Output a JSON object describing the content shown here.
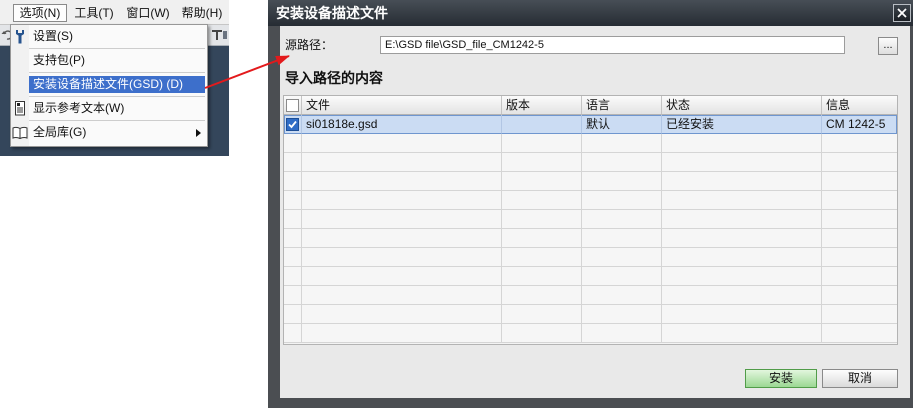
{
  "menubar": {
    "items": [
      {
        "label": "选项(N)",
        "active": true
      },
      {
        "label": "工具(T)"
      },
      {
        "label": "窗口(W)"
      },
      {
        "label": "帮助(H)"
      }
    ]
  },
  "options_menu": {
    "items": [
      {
        "label": "设置(S)",
        "icon": "wrench-icon"
      },
      {
        "label": "支持包(P)"
      },
      {
        "label": "安装设备描述文件(GSD) (D)",
        "highlighted": true
      },
      {
        "label": "显示参考文本(W)",
        "icon": "reference-text-icon"
      },
      {
        "label": "全局库(G)",
        "icon": "book-icon",
        "submenu": true
      }
    ]
  },
  "dialog": {
    "title": "安装设备描述文件",
    "close_icon": "close-icon",
    "source_path": {
      "label": "源路径：",
      "value": "E:\\GSD file\\GSD_file_CM1242-5"
    },
    "browse_label": "...",
    "section_title": "导入路径的内容",
    "table": {
      "select_all_checked": false,
      "columns": [
        "文件",
        "版本",
        "语言",
        "状态",
        "信息"
      ],
      "rows": [
        {
          "checked": true,
          "selected": true,
          "file": "si01818e.gsd",
          "version": "",
          "language": "默认",
          "status": "已经安装",
          "info": "CM 1242-5"
        }
      ]
    },
    "buttons": {
      "install": "安装",
      "cancel": "取消"
    }
  },
  "colors": {
    "menu_highlight": "#3d6fcb",
    "annotation_arrow": "#e31a1c",
    "install_button": "#9bd893",
    "title_bar": "#262c33",
    "selected_row": "#cbdcf3"
  }
}
